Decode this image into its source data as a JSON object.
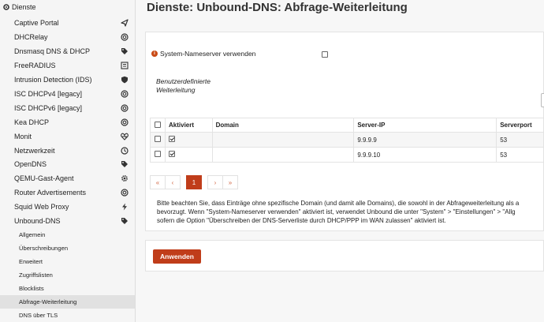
{
  "sidebar": {
    "header": {
      "label": "Dienste",
      "icon": "gear-icon"
    },
    "items": [
      {
        "label": "Captive Portal",
        "icon": "paper-plane-icon"
      },
      {
        "label": "DHCRelay",
        "icon": "bullseye-icon"
      },
      {
        "label": "Dnsmasq DNS & DHCP",
        "icon": "tags-icon"
      },
      {
        "label": "FreeRADIUS",
        "icon": "list-alt-icon"
      },
      {
        "label": "Intrusion Detection (IDS)",
        "icon": "shield-icon"
      },
      {
        "label": "ISC DHCPv4 [legacy]",
        "icon": "bullseye-icon"
      },
      {
        "label": "ISC DHCPv6 [legacy]",
        "icon": "bullseye-icon"
      },
      {
        "label": "Kea DHCP",
        "icon": "bullseye-icon"
      },
      {
        "label": "Monit",
        "icon": "heartbeat-icon"
      },
      {
        "label": "Netzwerkzeit",
        "icon": "clock-icon"
      },
      {
        "label": "OpenDNS",
        "icon": "tags-icon"
      },
      {
        "label": "QEMU-Gast-Agent",
        "icon": "gear-icon"
      },
      {
        "label": "Router Advertisements",
        "icon": "bullseye-icon"
      },
      {
        "label": "Squid Web Proxy",
        "icon": "bolt-icon"
      },
      {
        "label": "Unbound-DNS",
        "icon": "tags-icon"
      }
    ],
    "subitems": [
      {
        "label": "Allgemein"
      },
      {
        "label": "Überschreibungen"
      },
      {
        "label": "Erweitert"
      },
      {
        "label": "Zugriffslisten"
      },
      {
        "label": "Blocklists"
      },
      {
        "label": "Abfrage-Weiterleitung",
        "active": true
      },
      {
        "label": "DNS über TLS"
      }
    ]
  },
  "page": {
    "title": "Dienste: Unbound-DNS: Abfrage-Weiterleitung",
    "system_nameserver_label": "System-Nameserver verwenden",
    "system_nameserver_checked": false,
    "custom_forwarding_label": "Benutzerdefinierte Weiterleitung",
    "custom_forwarding_line1": "Benutzerdefinierte",
    "custom_forwarding_line2": "Weiterleitung"
  },
  "table": {
    "headers": [
      "Aktiviert",
      "Domain",
      "Server-IP",
      "Serverport"
    ],
    "rows": [
      {
        "enabled": true,
        "domain": "",
        "server_ip": "9.9.9.9",
        "port": "53"
      },
      {
        "enabled": true,
        "domain": "",
        "server_ip": "9.9.9.10",
        "port": "53"
      }
    ]
  },
  "pagination": {
    "first": "«",
    "prev": "‹",
    "current": "1",
    "next": "›",
    "last": "»"
  },
  "note": {
    "line1": "Bitte beachten Sie, dass Einträge ohne spezifische Domain (und damit alle Domains), die sowohl in der Abfrageweiterleitung als a",
    "line2": "bevorzugt. Wenn \"System-Nameserver verwenden\" aktiviert ist, verwendet Unbound die unter \"System\" > \"Einstellungen\" > \"Allg",
    "line3": "sofern die Option \"Überschreiben der DNS-Serverliste durch DHCP/PPP im WAN zulassen\" aktiviert ist."
  },
  "apply_label": "Anwenden",
  "colors": {
    "accent": "#c03d1a",
    "info": "#c94a16"
  }
}
